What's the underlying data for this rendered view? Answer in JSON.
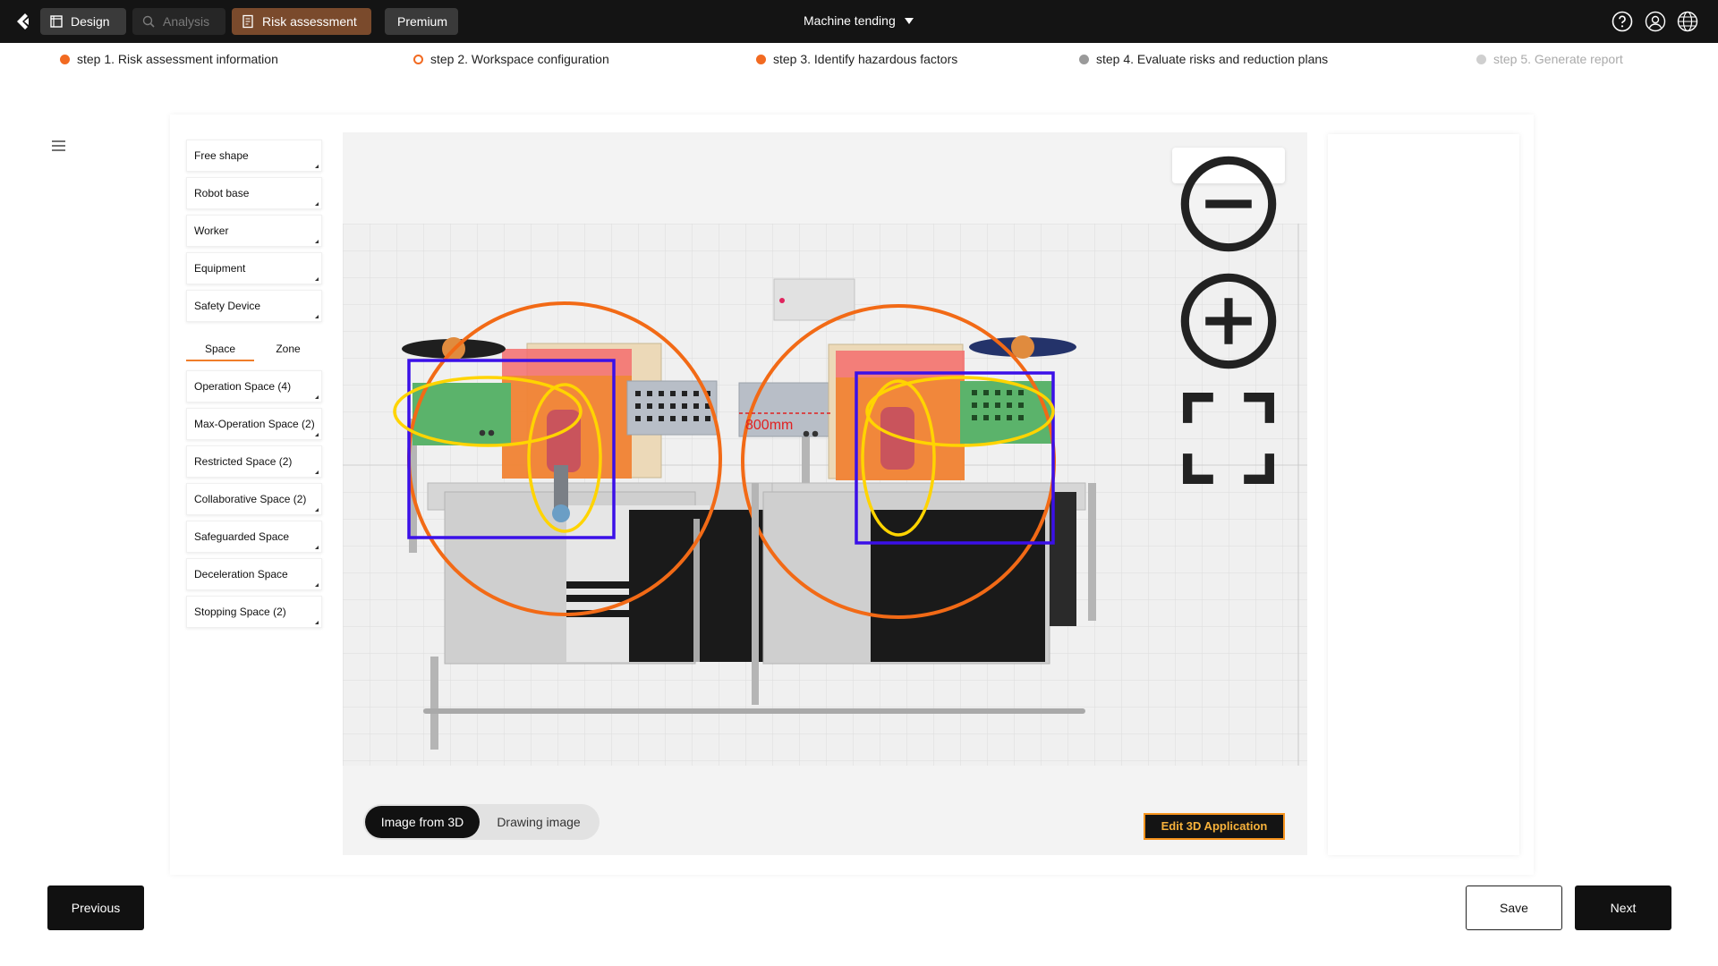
{
  "header": {
    "nav": [
      {
        "label": "Design",
        "state": "active"
      },
      {
        "label": "Analysis",
        "state": "disabled"
      },
      {
        "label": "Risk assessment",
        "state": "selected"
      },
      {
        "label": "Premium",
        "state": "normal"
      }
    ],
    "project_title": "Machine tending",
    "icons": [
      "back-logo-icon",
      "help-icon",
      "user-icon",
      "globe-icon"
    ]
  },
  "steps": [
    {
      "label": "step 1. Risk assessment information",
      "status": "done",
      "color": "#f26a21"
    },
    {
      "label": "step 2. Workspace configuration",
      "status": "current",
      "color": "#f26a21"
    },
    {
      "label": "step 3. Identify hazardous factors",
      "status": "done",
      "color": "#f26a21"
    },
    {
      "label": "step 4. Evaluate risks and reduction plans",
      "status": "pending",
      "color": "#9a9a9a"
    },
    {
      "label": "step 5. Generate report",
      "status": "disabled",
      "color": "#cfcfcf"
    }
  ],
  "sidebar": {
    "objects": [
      "Free shape",
      "Robot base",
      "Worker",
      "Equipment",
      "Safety Device"
    ],
    "tabs": [
      "Space",
      "Zone"
    ],
    "active_tab": "Space",
    "spaces": [
      "Operation Space (4)",
      "Max-Operation Space (2)",
      "Restricted Space (2)",
      "Collaborative Space (2)",
      "Safeguarded Space",
      "Deceleration Space",
      "Stopping Space (2)"
    ]
  },
  "viewer": {
    "distance_label": "800mm",
    "zoom_icons": [
      "zoom-out-icon",
      "zoom-in-icon",
      "fullscreen-icon"
    ],
    "colors": {
      "operation": "#f26a16",
      "restricted": "#3b10e8",
      "collab": "#ffd400",
      "zone_red": "#f56d6d",
      "zone_green": "#5bb36b"
    }
  },
  "view_toggle": {
    "options": [
      "Image from 3D",
      "Drawing image"
    ],
    "selected": "Image from 3D"
  },
  "edit_button": "Edit 3D Application",
  "footer": {
    "previous": "Previous",
    "save": "Save",
    "next": "Next"
  },
  "accent": "#f07d2a"
}
